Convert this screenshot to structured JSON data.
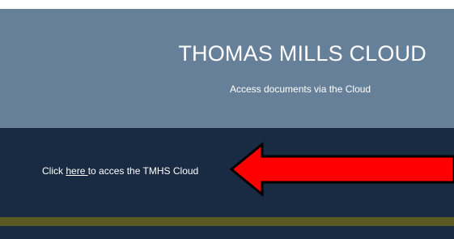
{
  "header": {
    "title": "THOMAS MILLS CLOUD",
    "subtitle": "Access documents via the Cloud"
  },
  "access": {
    "prefix": "Click ",
    "link_label": "here ",
    "suffix": "to acces the TMHS Cloud"
  },
  "arrow": {
    "icon": "red-arrow-left-icon",
    "fill": "#ff0000",
    "stroke": "#000000"
  },
  "colors": {
    "banner": "#67809a",
    "band": "#192b42",
    "accent_bar": "#5a5a22"
  }
}
